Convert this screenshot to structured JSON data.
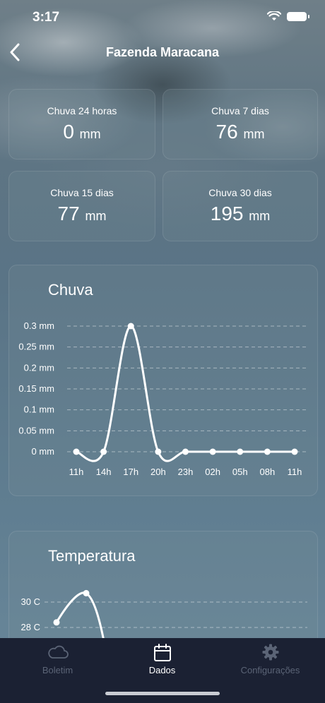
{
  "status_bar": {
    "time": "3:17"
  },
  "header": {
    "title": "Fazenda Maracana"
  },
  "stats": [
    {
      "label": "Chuva 24 horas",
      "value": "0",
      "unit": "mm"
    },
    {
      "label": "Chuva 7 dias",
      "value": "76",
      "unit": "mm"
    },
    {
      "label": "Chuva 15 dias",
      "value": "77",
      "unit": "mm"
    },
    {
      "label": "Chuva 30 dias",
      "value": "195",
      "unit": "mm"
    }
  ],
  "chart_data": [
    {
      "type": "line",
      "title": "Chuva",
      "categories": [
        "11h",
        "14h",
        "17h",
        "20h",
        "23h",
        "02h",
        "05h",
        "08h",
        "11h"
      ],
      "values": [
        0,
        0,
        0.3,
        0,
        0,
        0,
        0,
        0,
        0
      ],
      "yticks": [
        "0.3 mm",
        "0.25 mm",
        "0.2 mm",
        "0.15 mm",
        "0.1 mm",
        "0.05 mm",
        "0 mm"
      ],
      "ylim": [
        0,
        0.3
      ],
      "grid": true
    },
    {
      "type": "line",
      "title": "Temperatura",
      "values": [
        28.4,
        30.7
      ],
      "yticks": [
        "30 C",
        "28 C"
      ],
      "grid": true
    }
  ],
  "tabbar": {
    "tabs": [
      {
        "label": "Boletim",
        "icon": "cloud-icon",
        "active": false
      },
      {
        "label": "Dados",
        "icon": "calendar-icon",
        "active": true
      },
      {
        "label": "Configurações",
        "icon": "gear-icon",
        "active": false
      }
    ],
    "active_color": "#ffffff",
    "inactive_color": "#5b6476"
  }
}
